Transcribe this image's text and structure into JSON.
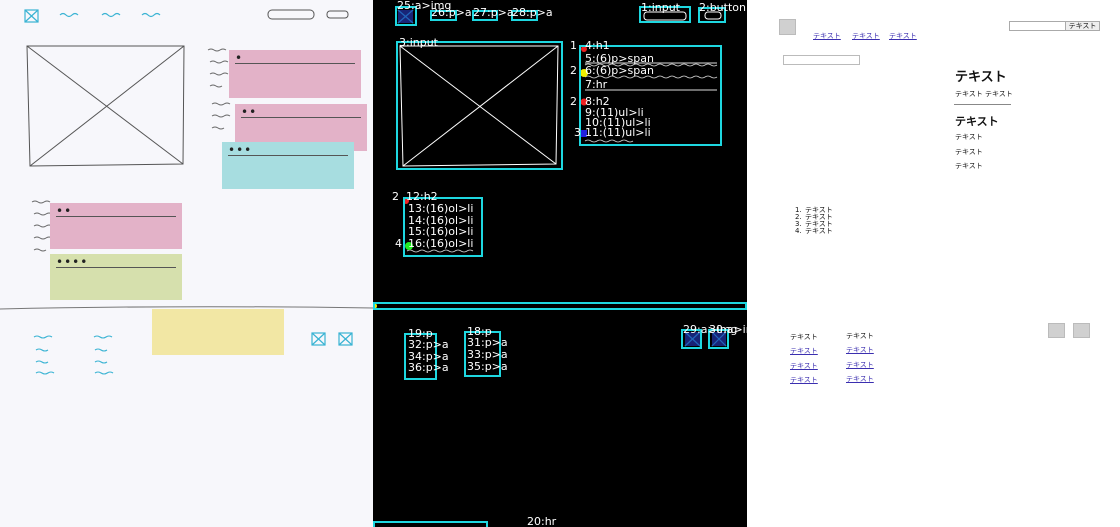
{
  "detections": {
    "img_link": "25:a>img",
    "link_1": "26:p>a",
    "link_2": "27:p>a",
    "link_3": "28:p>a",
    "input_top": "1:input",
    "button_top": "2:button",
    "input_hero": "3:input",
    "h1": "4:h1",
    "span_1": "5:(6)p>span",
    "span_2": "6:(6)p>span",
    "hr": "7:hr",
    "h2_main": "8:h2",
    "ul_li_1": "9:(11)ul>li",
    "ul_li_2": "10:(11)ul>li",
    "ul_li_3": "11:(11)ul>li",
    "h2_left": "12:h2",
    "ol_li_1": "13:(16)ol>li",
    "ol_li_2": "14:(16)ol>li",
    "ol_li_3": "15:(16)ol>li",
    "ol_li_4": "16:(16)ol>li",
    "footer_hr": "20:hr",
    "col1_p": "19:p",
    "col2_p": "18:p",
    "col1_a1": "32:p>a",
    "col1_a2": "34:p>a",
    "col1_a3": "36:p>a",
    "col2_a1": "31:p>a",
    "col2_a2": "33:p>a",
    "col2_a3": "35:p>a",
    "img_link_29": "29:a>img",
    "img_link_30": "30:a>img",
    "num_1a": "1",
    "num_2a": "2",
    "num_2b": "2",
    "num_3": "3",
    "num_2c": "2",
    "num_4": "4"
  },
  "render": {
    "nav_links": [
      "テキスト",
      "テキスト",
      "テキスト"
    ],
    "search_button": "テキスト",
    "h1": "テキスト",
    "subtext": "テキスト テキスト",
    "h2": "テキスト",
    "ul_items": [
      "テキスト",
      "テキスト",
      "テキスト"
    ],
    "ol_items": [
      "テキスト",
      "テキスト",
      "テキスト",
      "テキスト"
    ],
    "ol_markers": [
      "1.",
      "2.",
      "3.",
      "4."
    ],
    "footer_col1_title": "テキスト",
    "footer_col1_links": [
      "テキスト",
      "テキスト",
      "テキスト"
    ],
    "footer_col2_title": "テキスト",
    "footer_col2_links": [
      "テキスト",
      "テキスト",
      "テキスト"
    ]
  },
  "colors": {
    "detect_box": "#1ed7e0",
    "sticky_pink": "#e3b2c8",
    "sticky_cyan": "#a7dde0",
    "sticky_green": "#d6e0ad",
    "sticky_yellow": "#f2e7a4",
    "link": "#3b2fb0",
    "sketch_ink": "#39b3d3"
  },
  "icons": [
    "image-placeholder-icon",
    "wavy-text-icon",
    "marker-dot-icon"
  ]
}
